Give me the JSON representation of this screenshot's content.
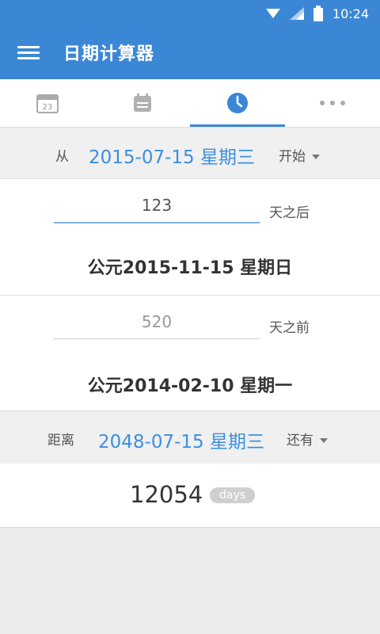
{
  "status": {
    "time": "10:24"
  },
  "app": {
    "title": "日期计算器"
  },
  "tabs": [
    {
      "icon": "calendar-23-icon",
      "day": "23",
      "active": false
    },
    {
      "icon": "calendar-icon",
      "active": false
    },
    {
      "icon": "clock-icon",
      "active": true
    },
    {
      "icon": "more-icon",
      "active": false
    }
  ],
  "from": {
    "label": "从",
    "date": "2015-07-15 星期三",
    "mode": "开始"
  },
  "after": {
    "value": "123",
    "suffix": "天之后",
    "result": "公元2015-11-15 星期日"
  },
  "before": {
    "value": "520",
    "suffix": "天之前",
    "result": "公元2014-02-10 星期一"
  },
  "distance": {
    "label": "距离",
    "date": "2048-07-15 星期三",
    "mode": "还有"
  },
  "days": {
    "count": "12054",
    "unit": "days"
  },
  "colors": {
    "primary": "#3b87d6",
    "link": "#3b8fe0"
  }
}
